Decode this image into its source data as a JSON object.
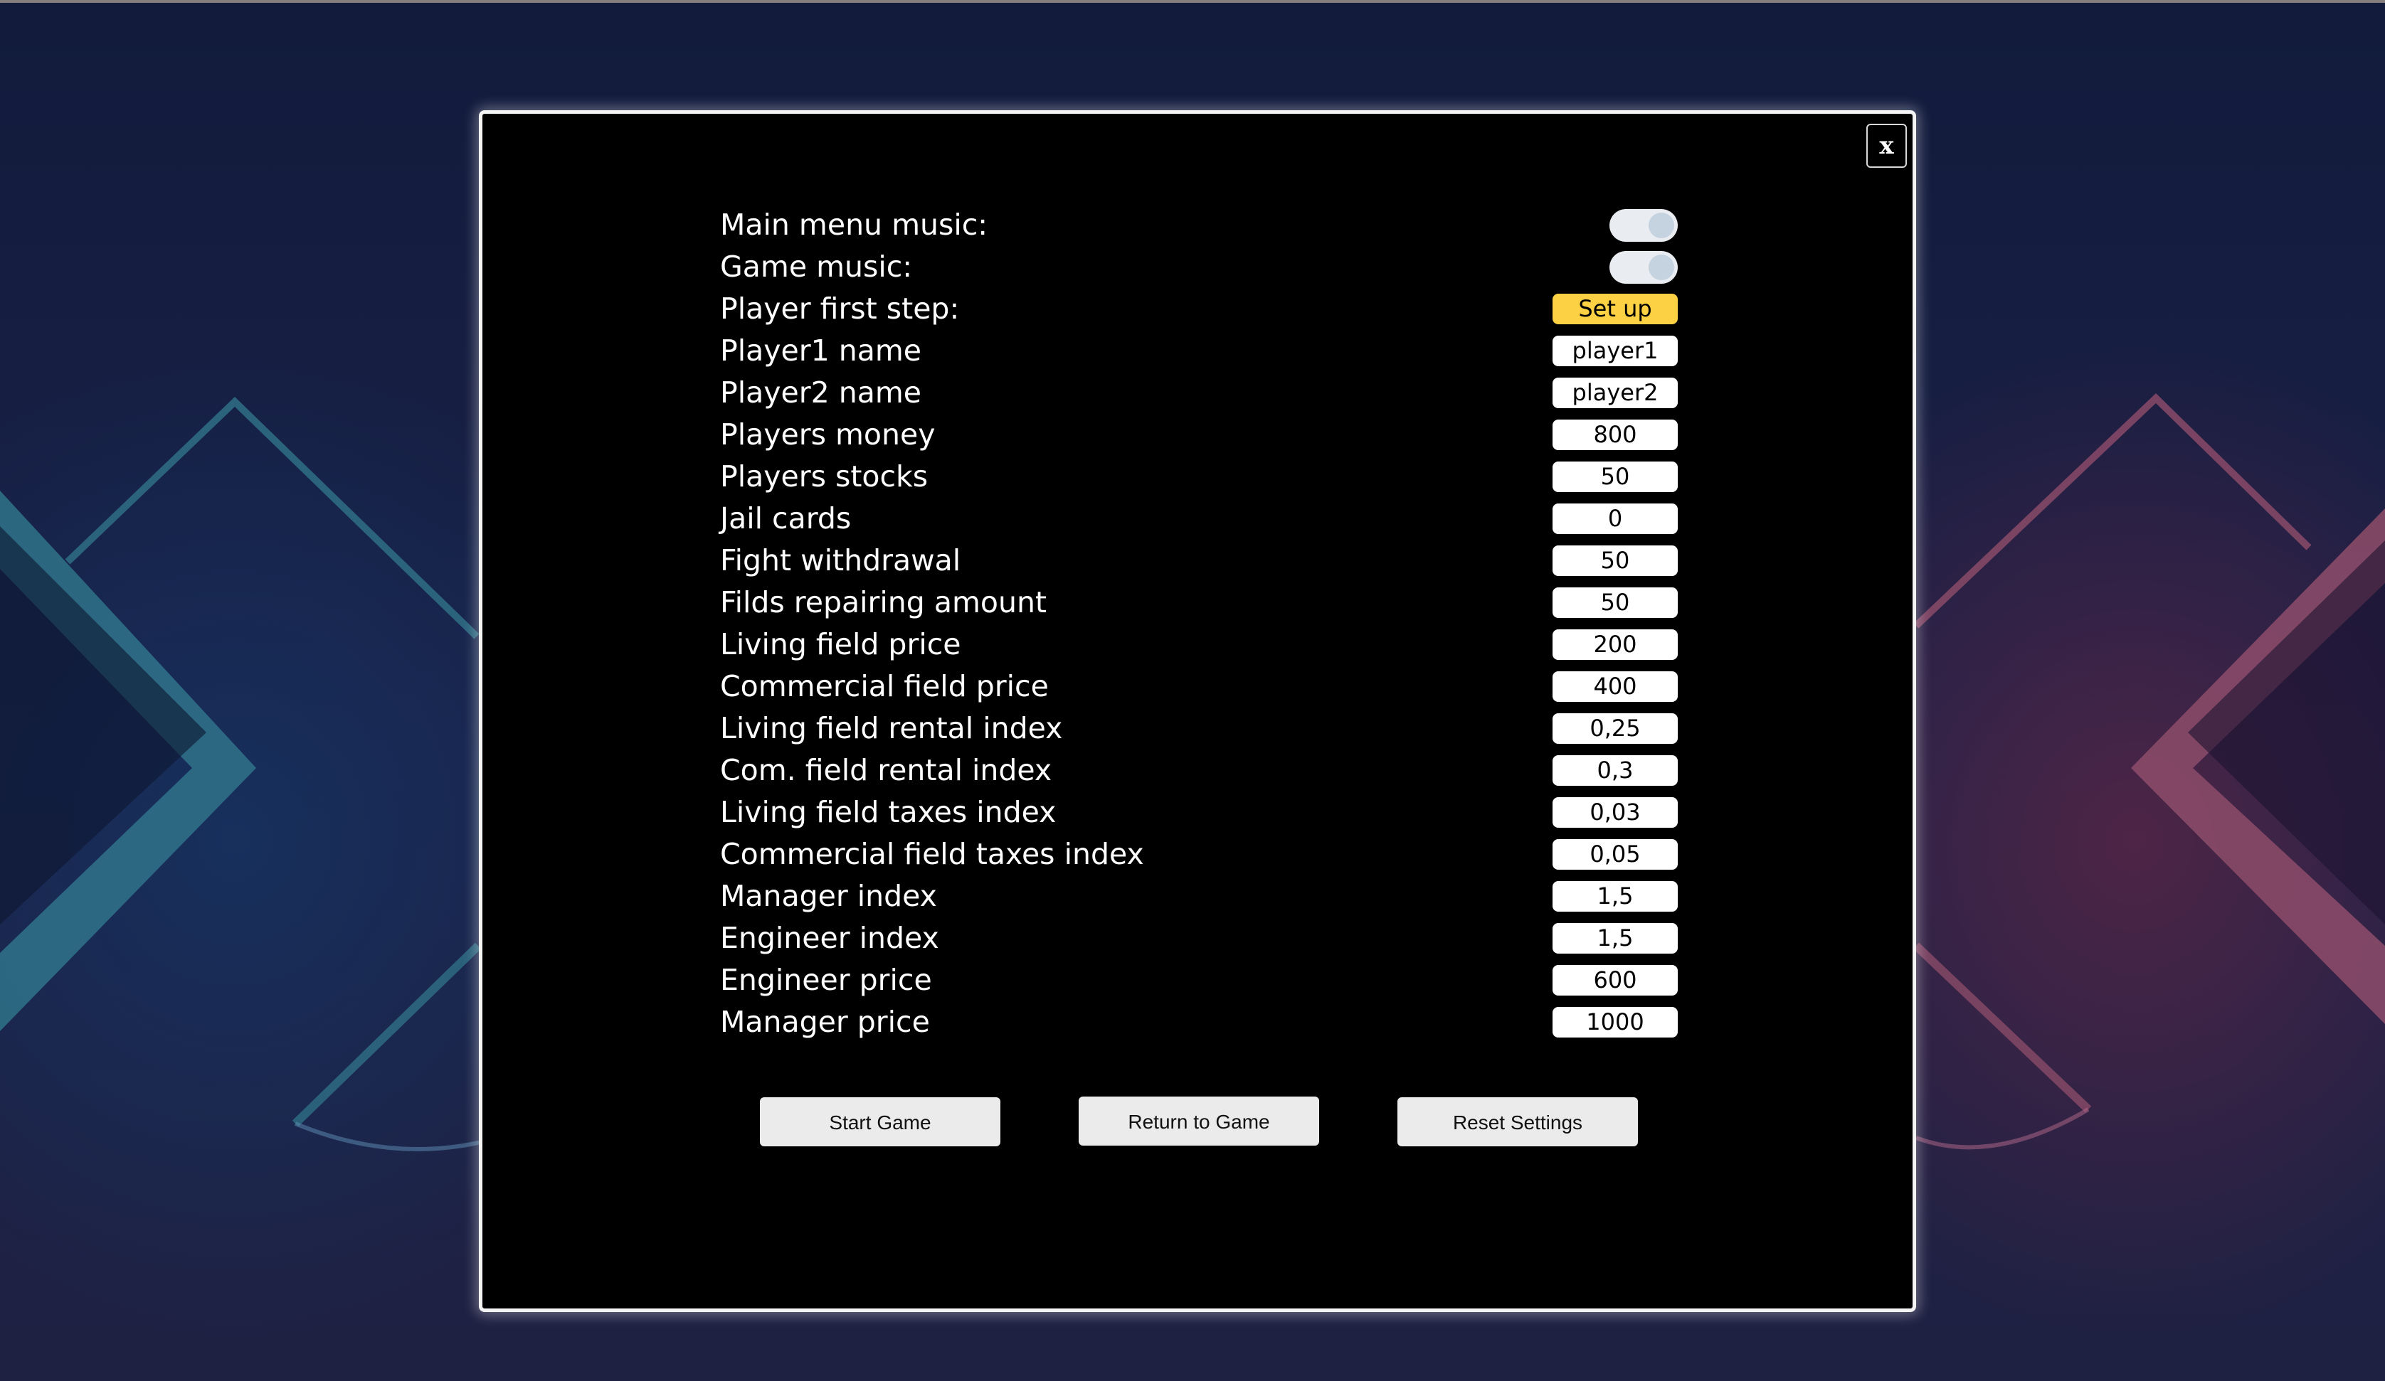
{
  "dialog": {
    "close_label": "x"
  },
  "settings": [
    {
      "label": "Main menu music:",
      "control": "toggle",
      "value": "on"
    },
    {
      "label": "Game music:",
      "control": "toggle",
      "value": "on"
    },
    {
      "label": "Player first step:",
      "control": "button",
      "value": "Set up"
    },
    {
      "label": "Player1 name",
      "control": "input",
      "value": "player1"
    },
    {
      "label": "Player2 name",
      "control": "input",
      "value": "player2"
    },
    {
      "label": "Players money",
      "control": "input",
      "value": "800"
    },
    {
      "label": "Players stocks",
      "control": "input",
      "value": "50"
    },
    {
      "label": "Jail cards",
      "control": "input",
      "value": "0"
    },
    {
      "label": "Fight withdrawal",
      "control": "input",
      "value": "50"
    },
    {
      "label": "Filds repairing amount",
      "control": "input",
      "value": "50"
    },
    {
      "label": "Living field price",
      "control": "input",
      "value": "200"
    },
    {
      "label": "Commercial field price",
      "control": "input",
      "value": "400"
    },
    {
      "label": "Living field rental index",
      "control": "input",
      "value": "0,25"
    },
    {
      "label": "Com. field rental index",
      "control": "input",
      "value": "0,3"
    },
    {
      "label": "Living field taxes index",
      "control": "input",
      "value": "0,03"
    },
    {
      "label": "Commercial field taxes index",
      "control": "input",
      "value": "0,05"
    },
    {
      "label": "Manager index",
      "control": "input",
      "value": "1,5"
    },
    {
      "label": "Engineer index",
      "control": "input",
      "value": "1,5"
    },
    {
      "label": "Engineer price",
      "control": "input",
      "value": "600"
    },
    {
      "label": "Manager price",
      "control": "input",
      "value": "1000"
    }
  ],
  "actions": {
    "start": "Start Game",
    "return": "Return to Game",
    "reset": "Reset Settings"
  },
  "colors": {
    "dialog_background": "#000000",
    "accent_button": "#fdd144",
    "field_background": "#ffffff",
    "toggle_track": "#e9ecf0"
  }
}
